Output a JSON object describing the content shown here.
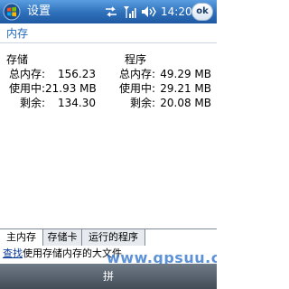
{
  "status_bar": {
    "app_title": "设置",
    "time": "14:20",
    "ok_label": "ok",
    "icons": [
      "windows-start-icon",
      "sync-arrows-icon",
      "signal-strength-icon",
      "speaker-volume-icon"
    ]
  },
  "page": {
    "title": "内存"
  },
  "storage": {
    "heading": "存储",
    "rows": [
      {
        "label": "总内存:",
        "value": "156.23"
      },
      {
        "label": "使用中:",
        "value": "21.93 MB"
      },
      {
        "label": "剩余:",
        "value": "134.30"
      }
    ]
  },
  "program": {
    "heading": "程序",
    "rows": [
      {
        "label": "总内存:",
        "value": "49.29 MB"
      },
      {
        "label": "使用中:",
        "value": "29.21 MB"
      },
      {
        "label": "剩余:",
        "value": "20.08 MB"
      }
    ]
  },
  "tabs": [
    {
      "label": "主内存",
      "active": true
    },
    {
      "label": "存储卡",
      "active": false
    },
    {
      "label": "运行的程序",
      "active": false
    }
  ],
  "hint": {
    "link_text": "查找",
    "rest_text": "使用存储内存的大文件"
  },
  "softkeys": {
    "sip_label": "拼"
  },
  "watermark": {
    "text": "www.gpsuu.com"
  },
  "colors": {
    "title_bar": "#2e6fb9",
    "page_title": "#2468b8",
    "link": "#0b3c9a",
    "softkey_bar": "#434d58"
  }
}
